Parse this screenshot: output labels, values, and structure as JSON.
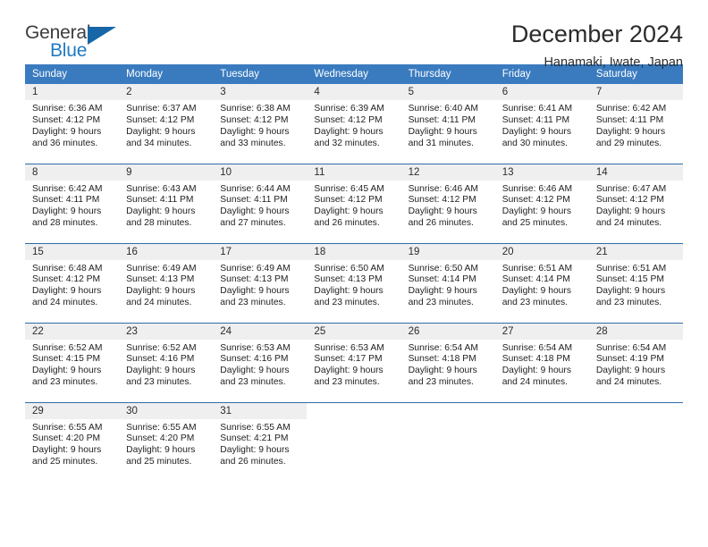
{
  "brand": {
    "name_part1": "General",
    "name_part2": "Blue",
    "accent_color": "#1f7ac4",
    "triangle_color": "#1766a8"
  },
  "header": {
    "title": "December 2024",
    "subtitle": "Hanamaki, Iwate, Japan"
  },
  "calendar": {
    "header_bg": "#3a7bbf",
    "daynum_bg": "#efefef",
    "row_divider": "#2f6ca8",
    "weekday_headers": [
      "Sunday",
      "Monday",
      "Tuesday",
      "Wednesday",
      "Thursday",
      "Friday",
      "Saturday"
    ],
    "weeks": [
      [
        {
          "day": "1",
          "sunrise": "Sunrise: 6:36 AM",
          "sunset": "Sunset: 4:12 PM",
          "daylight1": "Daylight: 9 hours",
          "daylight2": "and 36 minutes."
        },
        {
          "day": "2",
          "sunrise": "Sunrise: 6:37 AM",
          "sunset": "Sunset: 4:12 PM",
          "daylight1": "Daylight: 9 hours",
          "daylight2": "and 34 minutes."
        },
        {
          "day": "3",
          "sunrise": "Sunrise: 6:38 AM",
          "sunset": "Sunset: 4:12 PM",
          "daylight1": "Daylight: 9 hours",
          "daylight2": "and 33 minutes."
        },
        {
          "day": "4",
          "sunrise": "Sunrise: 6:39 AM",
          "sunset": "Sunset: 4:12 PM",
          "daylight1": "Daylight: 9 hours",
          "daylight2": "and 32 minutes."
        },
        {
          "day": "5",
          "sunrise": "Sunrise: 6:40 AM",
          "sunset": "Sunset: 4:11 PM",
          "daylight1": "Daylight: 9 hours",
          "daylight2": "and 31 minutes."
        },
        {
          "day": "6",
          "sunrise": "Sunrise: 6:41 AM",
          "sunset": "Sunset: 4:11 PM",
          "daylight1": "Daylight: 9 hours",
          "daylight2": "and 30 minutes."
        },
        {
          "day": "7",
          "sunrise": "Sunrise: 6:42 AM",
          "sunset": "Sunset: 4:11 PM",
          "daylight1": "Daylight: 9 hours",
          "daylight2": "and 29 minutes."
        }
      ],
      [
        {
          "day": "8",
          "sunrise": "Sunrise: 6:42 AM",
          "sunset": "Sunset: 4:11 PM",
          "daylight1": "Daylight: 9 hours",
          "daylight2": "and 28 minutes."
        },
        {
          "day": "9",
          "sunrise": "Sunrise: 6:43 AM",
          "sunset": "Sunset: 4:11 PM",
          "daylight1": "Daylight: 9 hours",
          "daylight2": "and 28 minutes."
        },
        {
          "day": "10",
          "sunrise": "Sunrise: 6:44 AM",
          "sunset": "Sunset: 4:11 PM",
          "daylight1": "Daylight: 9 hours",
          "daylight2": "and 27 minutes."
        },
        {
          "day": "11",
          "sunrise": "Sunrise: 6:45 AM",
          "sunset": "Sunset: 4:12 PM",
          "daylight1": "Daylight: 9 hours",
          "daylight2": "and 26 minutes."
        },
        {
          "day": "12",
          "sunrise": "Sunrise: 6:46 AM",
          "sunset": "Sunset: 4:12 PM",
          "daylight1": "Daylight: 9 hours",
          "daylight2": "and 26 minutes."
        },
        {
          "day": "13",
          "sunrise": "Sunrise: 6:46 AM",
          "sunset": "Sunset: 4:12 PM",
          "daylight1": "Daylight: 9 hours",
          "daylight2": "and 25 minutes."
        },
        {
          "day": "14",
          "sunrise": "Sunrise: 6:47 AM",
          "sunset": "Sunset: 4:12 PM",
          "daylight1": "Daylight: 9 hours",
          "daylight2": "and 24 minutes."
        }
      ],
      [
        {
          "day": "15",
          "sunrise": "Sunrise: 6:48 AM",
          "sunset": "Sunset: 4:12 PM",
          "daylight1": "Daylight: 9 hours",
          "daylight2": "and 24 minutes."
        },
        {
          "day": "16",
          "sunrise": "Sunrise: 6:49 AM",
          "sunset": "Sunset: 4:13 PM",
          "daylight1": "Daylight: 9 hours",
          "daylight2": "and 24 minutes."
        },
        {
          "day": "17",
          "sunrise": "Sunrise: 6:49 AM",
          "sunset": "Sunset: 4:13 PM",
          "daylight1": "Daylight: 9 hours",
          "daylight2": "and 23 minutes."
        },
        {
          "day": "18",
          "sunrise": "Sunrise: 6:50 AM",
          "sunset": "Sunset: 4:13 PM",
          "daylight1": "Daylight: 9 hours",
          "daylight2": "and 23 minutes."
        },
        {
          "day": "19",
          "sunrise": "Sunrise: 6:50 AM",
          "sunset": "Sunset: 4:14 PM",
          "daylight1": "Daylight: 9 hours",
          "daylight2": "and 23 minutes."
        },
        {
          "day": "20",
          "sunrise": "Sunrise: 6:51 AM",
          "sunset": "Sunset: 4:14 PM",
          "daylight1": "Daylight: 9 hours",
          "daylight2": "and 23 minutes."
        },
        {
          "day": "21",
          "sunrise": "Sunrise: 6:51 AM",
          "sunset": "Sunset: 4:15 PM",
          "daylight1": "Daylight: 9 hours",
          "daylight2": "and 23 minutes."
        }
      ],
      [
        {
          "day": "22",
          "sunrise": "Sunrise: 6:52 AM",
          "sunset": "Sunset: 4:15 PM",
          "daylight1": "Daylight: 9 hours",
          "daylight2": "and 23 minutes."
        },
        {
          "day": "23",
          "sunrise": "Sunrise: 6:52 AM",
          "sunset": "Sunset: 4:16 PM",
          "daylight1": "Daylight: 9 hours",
          "daylight2": "and 23 minutes."
        },
        {
          "day": "24",
          "sunrise": "Sunrise: 6:53 AM",
          "sunset": "Sunset: 4:16 PM",
          "daylight1": "Daylight: 9 hours",
          "daylight2": "and 23 minutes."
        },
        {
          "day": "25",
          "sunrise": "Sunrise: 6:53 AM",
          "sunset": "Sunset: 4:17 PM",
          "daylight1": "Daylight: 9 hours",
          "daylight2": "and 23 minutes."
        },
        {
          "day": "26",
          "sunrise": "Sunrise: 6:54 AM",
          "sunset": "Sunset: 4:18 PM",
          "daylight1": "Daylight: 9 hours",
          "daylight2": "and 23 minutes."
        },
        {
          "day": "27",
          "sunrise": "Sunrise: 6:54 AM",
          "sunset": "Sunset: 4:18 PM",
          "daylight1": "Daylight: 9 hours",
          "daylight2": "and 24 minutes."
        },
        {
          "day": "28",
          "sunrise": "Sunrise: 6:54 AM",
          "sunset": "Sunset: 4:19 PM",
          "daylight1": "Daylight: 9 hours",
          "daylight2": "and 24 minutes."
        }
      ],
      [
        {
          "day": "29",
          "sunrise": "Sunrise: 6:55 AM",
          "sunset": "Sunset: 4:20 PM",
          "daylight1": "Daylight: 9 hours",
          "daylight2": "and 25 minutes."
        },
        {
          "day": "30",
          "sunrise": "Sunrise: 6:55 AM",
          "sunset": "Sunset: 4:20 PM",
          "daylight1": "Daylight: 9 hours",
          "daylight2": "and 25 minutes."
        },
        {
          "day": "31",
          "sunrise": "Sunrise: 6:55 AM",
          "sunset": "Sunset: 4:21 PM",
          "daylight1": "Daylight: 9 hours",
          "daylight2": "and 26 minutes."
        },
        {
          "day": "",
          "sunrise": "",
          "sunset": "",
          "daylight1": "",
          "daylight2": ""
        },
        {
          "day": "",
          "sunrise": "",
          "sunset": "",
          "daylight1": "",
          "daylight2": ""
        },
        {
          "day": "",
          "sunrise": "",
          "sunset": "",
          "daylight1": "",
          "daylight2": ""
        },
        {
          "day": "",
          "sunrise": "",
          "sunset": "",
          "daylight1": "",
          "daylight2": ""
        }
      ]
    ]
  }
}
